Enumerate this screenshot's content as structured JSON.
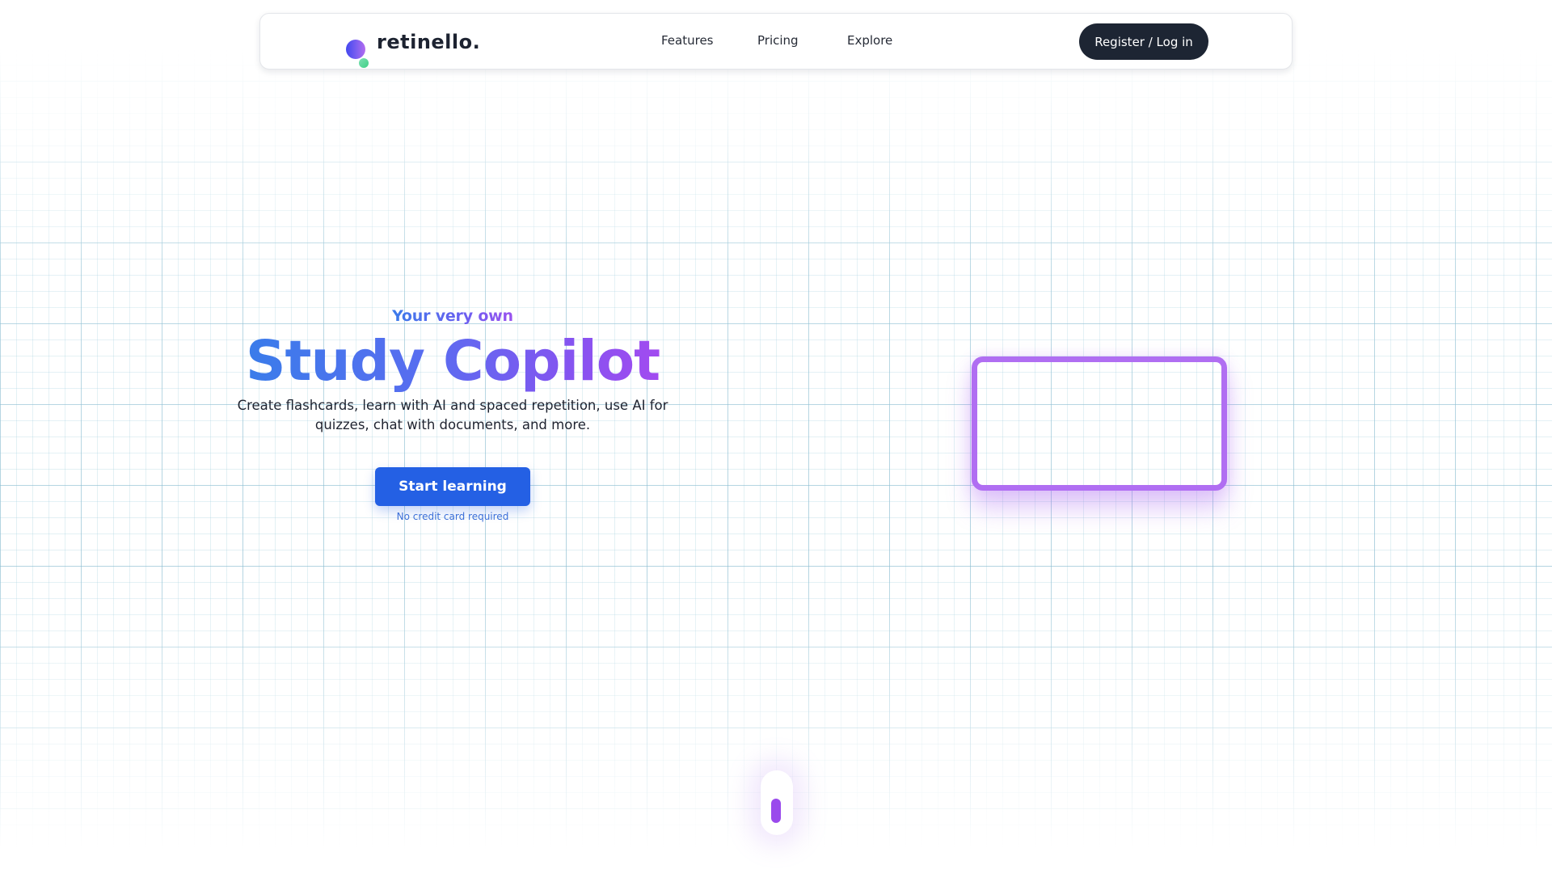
{
  "brand": {
    "name": "retinello.",
    "logo_icon": "two-dots-logo",
    "colors": {
      "logo_primary_start": "#4348ef",
      "logo_primary_end": "#b36cf0",
      "logo_secondary": "#3fcf86",
      "heading_gradient_start": "#3a7cea",
      "heading_gradient_end": "#a24bf0",
      "cta": "#2460e4",
      "nav_button": "#1d2533",
      "card_border": "#b06ef2",
      "scroll_dot": "#9a4aec"
    }
  },
  "nav": {
    "links": [
      {
        "label": "Features"
      },
      {
        "label": "Pricing"
      },
      {
        "label": "Explore"
      }
    ],
    "auth_button": "Register / Log in"
  },
  "hero": {
    "eyebrow": "Your very own",
    "title": "Study Copilot",
    "subtitle_line1": "Create flashcards, learn with AI and spaced repetition, use AI for",
    "subtitle_line2": "quizzes, chat with documents, and more.",
    "cta_label": "Start learning",
    "cta_note": "No credit card required"
  },
  "preview": {
    "icon": "empty-preview-card"
  },
  "scroll": {
    "icon": "mouse-scroll-indicator"
  }
}
